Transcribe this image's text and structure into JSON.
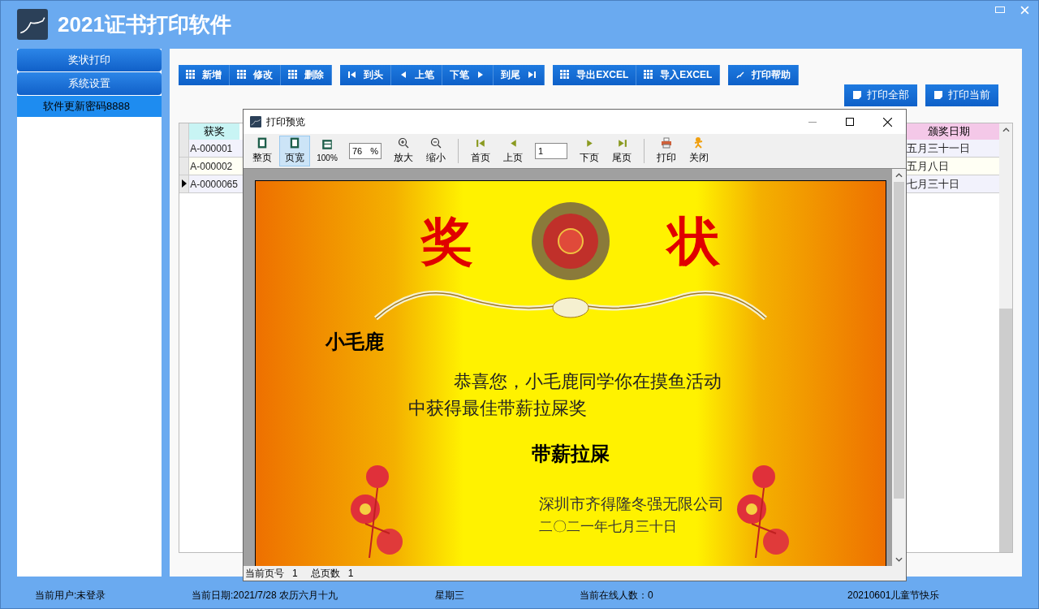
{
  "app": {
    "title": "2021证书打印软件"
  },
  "sidebar": {
    "items": [
      {
        "label": "奖状打印",
        "kind": "button",
        "selected": false
      },
      {
        "label": "系统设置",
        "kind": "button",
        "selected": false
      },
      {
        "label": "软件更新密码8888",
        "kind": "link",
        "selected": true
      }
    ]
  },
  "toolbar": {
    "groups": [
      [
        "新增",
        "修改",
        "删除"
      ],
      [
        "到头",
        "上笔",
        "下笔",
        "到尾"
      ],
      [
        "导出EXCEL",
        "导入EXCEL"
      ],
      [
        "打印帮助"
      ]
    ]
  },
  "print_buttons": [
    "打印全部",
    "打印当前"
  ],
  "table": {
    "columns": [
      "获奖",
      "颁奖日期"
    ],
    "rows": [
      {
        "cells": [
          "A-000001",
          "五月三十一日"
        ],
        "selected": false
      },
      {
        "cells": [
          "A-000002",
          "五月八日"
        ],
        "selected": false
      },
      {
        "cells": [
          "A-0000065",
          "七月三十日"
        ],
        "selected": true
      }
    ]
  },
  "dialog": {
    "title": "打印预览",
    "toolbar": [
      {
        "kind": "button",
        "label": "整页",
        "selected": false
      },
      {
        "kind": "button",
        "label": "页宽",
        "selected": true
      },
      {
        "kind": "button",
        "label": "100%",
        "selected": false
      },
      {
        "kind": "zoom",
        "value": "76",
        "unit": "%"
      },
      {
        "kind": "button",
        "label": "放大",
        "selected": false
      },
      {
        "kind": "button",
        "label": "缩小",
        "selected": false
      },
      {
        "kind": "sep"
      },
      {
        "kind": "button",
        "label": "首页",
        "selected": false
      },
      {
        "kind": "button",
        "label": "上页",
        "selected": false
      },
      {
        "kind": "page",
        "value": "1"
      },
      {
        "kind": "button",
        "label": "下页",
        "selected": false
      },
      {
        "kind": "button",
        "label": "尾页",
        "selected": false
      },
      {
        "kind": "sep"
      },
      {
        "kind": "button",
        "label": "打印",
        "selected": false
      },
      {
        "kind": "button",
        "label": "关闭",
        "selected": false
      }
    ],
    "certificate": {
      "title_chars": [
        "奖",
        "状"
      ],
      "name": "小毛鹿",
      "body": "恭喜您，小毛鹿同学你在摸鱼活动中获得最佳带薪拉屎奖",
      "award": "带薪拉屎",
      "issuer": "深圳市齐得隆冬强无限公司",
      "date": "二〇二一年七月三十日"
    },
    "status": [
      {
        "label": "当前页号",
        "value": "1"
      },
      {
        "label": "总页数",
        "value": "1"
      }
    ]
  },
  "status_bar": [
    "当前用户:未登录",
    "当前日期:2021/7/28 农历六月十九",
    "星期三",
    "当前在线人数：0",
    "20210601儿童节快乐"
  ]
}
